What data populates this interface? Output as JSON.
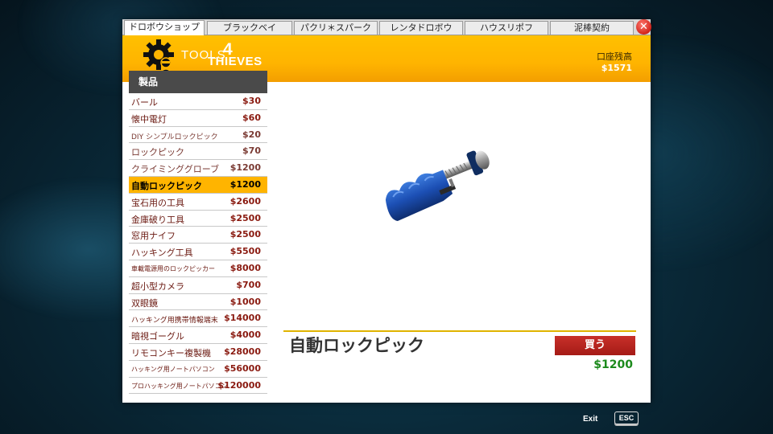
{
  "tabs": [
    {
      "label": "ドロボウショップ"
    },
    {
      "label": "ブラックベイ"
    },
    {
      "label": "パクリ＊スパーク"
    },
    {
      "label": "レンタドロボウ"
    },
    {
      "label": "ハウスリポフ"
    },
    {
      "label": "泥棒契約"
    }
  ],
  "close_symbol": "✕",
  "logo": {
    "tools": "TOOLS",
    "four": "4",
    "thieves": "THIEVES"
  },
  "balance": {
    "label": "口座残高",
    "value": "$1571"
  },
  "products_header": "製品",
  "products": [
    {
      "name": "バール",
      "price": "$30"
    },
    {
      "name": "懐中電灯",
      "price": "$60"
    },
    {
      "name": "DIY シンプルロックピック",
      "price": "$20"
    },
    {
      "name": "ロックピック",
      "price": "$70"
    },
    {
      "name": "クライミンググローブ",
      "price": "$1200"
    },
    {
      "name": "自動ロックピック",
      "price": "$1200"
    },
    {
      "name": "宝石用の工具",
      "price": "$2600"
    },
    {
      "name": "金庫破り工具",
      "price": "$2500"
    },
    {
      "name": "窓用ナイフ",
      "price": "$2500"
    },
    {
      "name": "ハッキング工具",
      "price": "$5500"
    },
    {
      "name": "車載電源用のロックピッカー",
      "price": "$8000"
    },
    {
      "name": "超小型カメラ",
      "price": "$700"
    },
    {
      "name": "双眼鏡",
      "price": "$1000"
    },
    {
      "name": "ハッキング用携帯情報端末",
      "price": "$14000"
    },
    {
      "name": "暗視ゴーグル",
      "price": "$4000"
    },
    {
      "name": "リモコンキー複製機",
      "price": "$28000"
    },
    {
      "name": "ハッキング用ノートパソコン",
      "price": "$56000"
    },
    {
      "name": "プロハッキング用ノートパソコン",
      "price": "$120000"
    }
  ],
  "selected_product": {
    "name": "自動ロックピック",
    "price": "$1200"
  },
  "buy_label": "買う",
  "footer": {
    "exit_label": "Exit",
    "esc_key": "ESC"
  },
  "colors": {
    "accent": "#ffb400",
    "buy_button": "#b8241e",
    "price_green": "#1c8a1c",
    "header_bar": "#4a4a4a"
  },
  "icons": {
    "logo": "gear-thief-icon",
    "preview": "auto-lockpick-tool-icon",
    "close": "close-icon"
  }
}
